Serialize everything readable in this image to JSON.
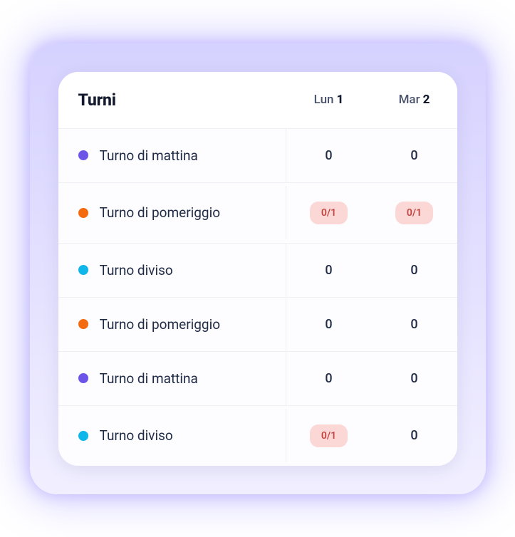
{
  "header": {
    "title": "Turni",
    "days": [
      {
        "short": "Lun",
        "num": "1"
      },
      {
        "short": "Mar",
        "num": "2"
      }
    ]
  },
  "colors": {
    "purple": "#6d54e8",
    "orange": "#f36a0f",
    "cyan": "#0fb6e9"
  },
  "rows": [
    {
      "name": "Turno di mattina",
      "colorKey": "purple",
      "cells": [
        {
          "text": "0",
          "badge": false
        },
        {
          "text": "0",
          "badge": false
        }
      ]
    },
    {
      "name": "Turno di pomeriggio",
      "colorKey": "orange",
      "cells": [
        {
          "text": "0/1",
          "badge": true
        },
        {
          "text": "0/1",
          "badge": true
        }
      ]
    },
    {
      "name": "Turno diviso",
      "colorKey": "cyan",
      "cells": [
        {
          "text": "0",
          "badge": false
        },
        {
          "text": "0",
          "badge": false
        }
      ]
    },
    {
      "name": "Turno di pomeriggio",
      "colorKey": "orange",
      "cells": [
        {
          "text": "0",
          "badge": false
        },
        {
          "text": "0",
          "badge": false
        }
      ]
    },
    {
      "name": "Turno di mattina",
      "colorKey": "purple",
      "cells": [
        {
          "text": "0",
          "badge": false
        },
        {
          "text": "0",
          "badge": false
        }
      ]
    },
    {
      "name": "Turno diviso",
      "colorKey": "cyan",
      "cells": [
        {
          "text": "0/1",
          "badge": true
        },
        {
          "text": "0",
          "badge": false
        }
      ]
    }
  ]
}
